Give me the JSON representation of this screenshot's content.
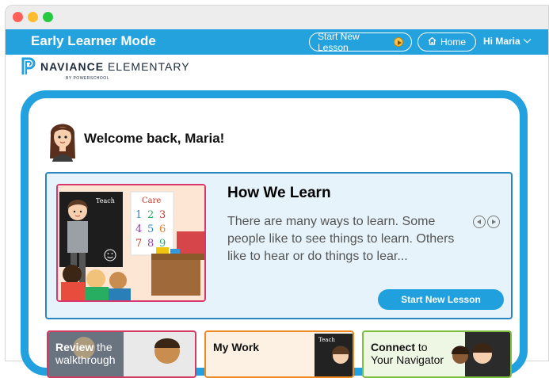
{
  "app": {
    "mode_title": "Early Learner Mode",
    "start_new_lesson": "Start New Lesson",
    "home": "Home",
    "user_greeting": "Hi Maria"
  },
  "brand": {
    "name_bold": "NAVIANCE",
    "name_rest": "ELEMENTARY",
    "sub": "BY POWERSCHOOL"
  },
  "welcome": {
    "text": "Welcome back, Maria!"
  },
  "lesson": {
    "title": "How We Learn",
    "description": "There are many ways to learn. Some people like to see things to learn. Others like to hear or do things to lear...",
    "button": "Start New Lesson",
    "image": {
      "board_label": "Teach",
      "chart_title": "Care",
      "numbers": [
        "1",
        "2",
        "3",
        "4",
        "5",
        "6",
        "7",
        "8",
        "9"
      ]
    }
  },
  "tiles": {
    "review": {
      "bold": "Review",
      "rest": " the",
      "line2": "walkthrough"
    },
    "mywork": {
      "bold": "My Work",
      "board_label": "Teach"
    },
    "connect": {
      "bold": "Connect",
      "rest": " to",
      "line2": "Your Navigator"
    }
  },
  "colors": {
    "primary_blue": "#23a2dd",
    "card_bg": "#e6f3fa",
    "card_border": "#2a86bf",
    "review_border": "#d13b61",
    "mywork_border": "#f08a24",
    "connect_border": "#7dbd3e"
  }
}
